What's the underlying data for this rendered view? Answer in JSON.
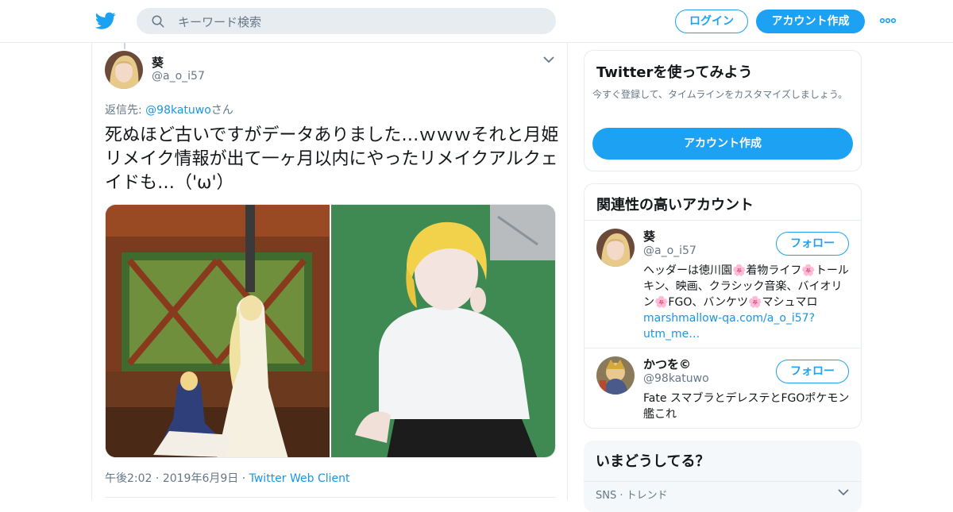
{
  "header": {
    "search_placeholder": "キーワード検索",
    "login_label": "ログイン",
    "signup_label": "アカウント作成"
  },
  "tweet": {
    "author_name": "葵",
    "author_handle": "@a_o_i57",
    "reply_prefix": "返信先: ",
    "reply_handle": "@98katuwo",
    "reply_suffix": "さん",
    "text": "死ぬほど古いですがデータありました…ｗｗｗそれと月姫リメイク情報が出て一ヶ月以内にやったリメイクアルクェイドも…（'ω'）",
    "time": "午後2:02",
    "date": "2019年6月9日",
    "source": "Twitter Web Client"
  },
  "signup_card": {
    "title": "Twitterを使ってみよう",
    "description": "今すぐ登録して、タイムラインをカスタマイズしましょう。",
    "button_label": "アカウント作成"
  },
  "related": {
    "title": "関連性の高いアカウント",
    "accounts": [
      {
        "name": "葵",
        "handle": "@a_o_i57",
        "follow_label": "フォロー",
        "bio": "ヘッダーは徳川園🌸着物ライフ🌸トールキン、映画、クラシック音楽、バイオリン🌸FGO、バンケツ🌸マシュマロ",
        "bio_link": "marshmallow-qa.com/a_o_i57?utm_me…"
      },
      {
        "name": "かつを©",
        "handle": "@98katuwo",
        "follow_label": "フォロー",
        "bio": "Fate スマブラとデレステとFGOポケモン艦これ",
        "bio_link": ""
      }
    ]
  },
  "trends": {
    "title": "いまどうしてる？",
    "label": "SNS · トレンド"
  },
  "colors": {
    "brand": "#1da1f2",
    "link": "#1b95e0",
    "secondary_text": "#657786",
    "border": "#e6ecf0"
  }
}
